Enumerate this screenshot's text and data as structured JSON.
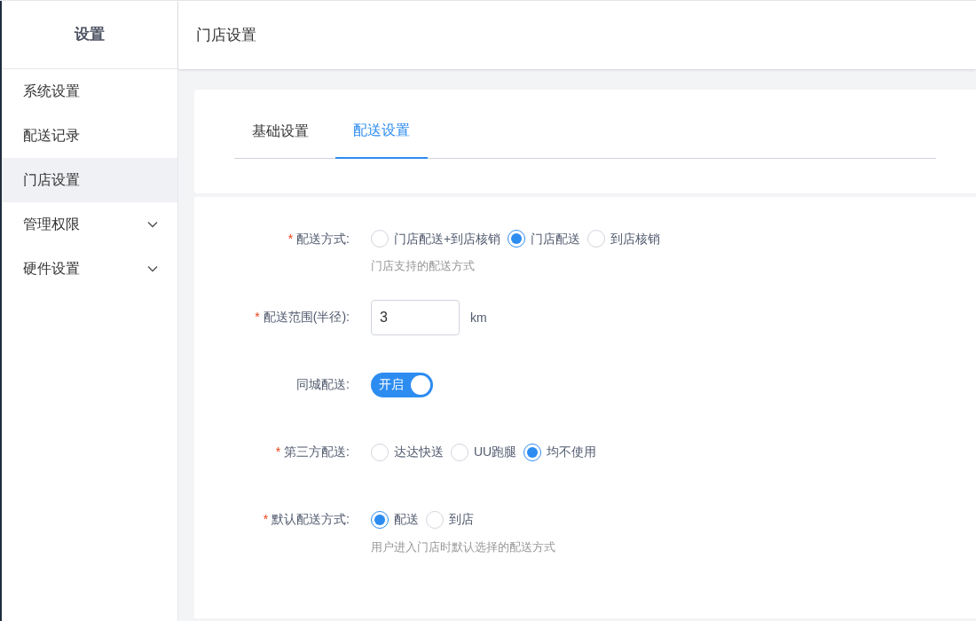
{
  "sidebar": {
    "title": "设置",
    "items": [
      {
        "label": "系统设置",
        "selected": false,
        "expandable": false
      },
      {
        "label": "配送记录",
        "selected": false,
        "expandable": false
      },
      {
        "label": "门店设置",
        "selected": true,
        "expandable": false
      },
      {
        "label": "管理权限",
        "selected": false,
        "expandable": true
      },
      {
        "label": "硬件设置",
        "selected": false,
        "expandable": true
      }
    ]
  },
  "header": {
    "title": "门店设置"
  },
  "tabs": [
    {
      "label": "基础设置",
      "selected": false
    },
    {
      "label": "配送设置",
      "selected": true
    }
  ],
  "form": [
    {
      "kind": "radio",
      "mark": "*",
      "label": "配送方式:",
      "options": [
        {
          "label": "门店配送+到店核销",
          "selected": false
        },
        {
          "label": "门店配送",
          "selected": true
        },
        {
          "label": "到店核销",
          "selected": false
        }
      ],
      "hint": "门店支持的配送方式"
    },
    {
      "kind": "input",
      "mark": "*",
      "label": "配送范围(半径):",
      "value": "3",
      "unit": "km"
    },
    {
      "kind": "switch",
      "label": "同城配送:",
      "on": true,
      "text": "开启"
    },
    {
      "kind": "radio",
      "mark": "*",
      "label": "第三方配送:",
      "options": [
        {
          "label": "达达快送",
          "selected": false
        },
        {
          "label": "UU跑腿",
          "selected": false
        },
        {
          "label": "均不使用",
          "selected": true
        }
      ]
    },
    {
      "kind": "radio",
      "mark": "*",
      "label": "默认配送方式:",
      "options": [
        {
          "label": "配送",
          "selected": true
        },
        {
          "label": "到店",
          "selected": false
        }
      ],
      "hint": "用户进入门店时默认选择的配送方式"
    }
  ]
}
